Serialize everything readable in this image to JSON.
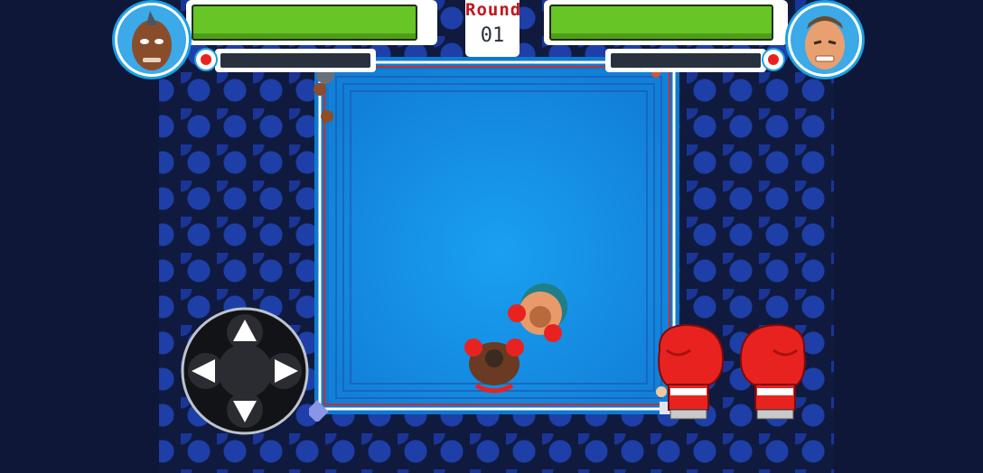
{
  "round": {
    "label": "Round",
    "number": "01"
  },
  "player": {
    "name_icon": "mohawk-boxer-portrait",
    "health": 1.0,
    "stamina": 0.0
  },
  "opponent": {
    "name_icon": "veteran-boxer-portrait",
    "health": 1.0,
    "stamina": 0.0
  },
  "controls": {
    "dpad_icons": [
      "arrow-up-icon",
      "arrow-down-icon",
      "arrow-left-icon",
      "arrow-right-icon"
    ],
    "left_punch_icon": "red-boxing-glove-icon",
    "right_punch_icon": "red-boxing-glove-icon"
  },
  "colors": {
    "ring_canvas": "#1aa0f0",
    "health_green": "#67c526",
    "round_red": "#c4141a",
    "glove_red": "#e8231f"
  }
}
